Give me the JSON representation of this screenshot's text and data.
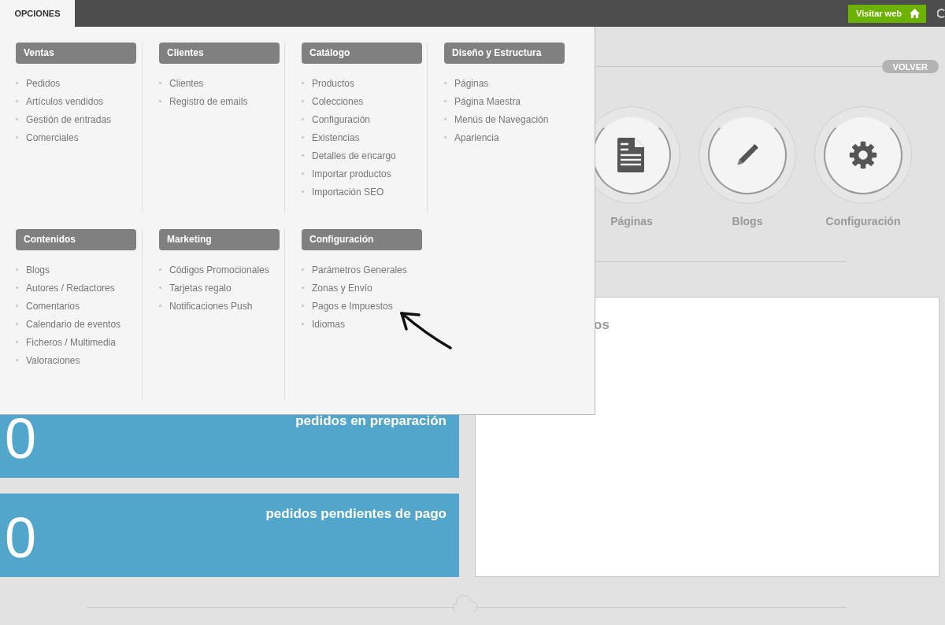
{
  "top_bar": {
    "tab": {
      "label": "OPCIONES",
      "selected": true
    },
    "visit_button": "Visitar web"
  },
  "menu": {
    "rows": [
      [
        {
          "title": "Ventas",
          "items": [
            "Pedidos",
            "Artículos vendidos",
            "Gestión de entradas",
            "Comerciales"
          ]
        },
        {
          "title": "Clientes",
          "items": [
            "Clientes",
            "Registro de emails"
          ]
        },
        {
          "title": "Catálogo",
          "items": [
            "Productos",
            "Colecciones",
            "Configuración",
            "Existencias",
            "Detalles de encargo",
            "Importar productos",
            "Importación SEO"
          ]
        },
        {
          "title": "Diseño y Estructura",
          "items": [
            "Páginas",
            "Página Maestra",
            "Menús de Navegación",
            "Apariencia"
          ]
        }
      ],
      [
        {
          "title": "Contenidos",
          "items": [
            "Blogs",
            "Autores / Redactores",
            "Comentarios",
            "Calendario de eventos",
            "Ficheros / Multimedia",
            "Valoraciones"
          ]
        },
        {
          "title": "Marketing",
          "items": [
            "Códigos Promocionales",
            "Tarjetas regalo",
            "Notificaciones Push"
          ]
        },
        {
          "title": "Configuración",
          "items": [
            "Parámetros Generales",
            "Zonas y Envío",
            "Pagos e Impuestos",
            "Idiomas"
          ]
        }
      ]
    ]
  },
  "volver_button": "VOLVER",
  "shortcuts": [
    {
      "label": "Páginas",
      "kind": "document"
    },
    {
      "label": "Blogs",
      "kind": "pencil"
    },
    {
      "label": "Configuración",
      "kind": "gear"
    }
  ],
  "stats": [
    {
      "value": "0",
      "label": "pedidos en preparación"
    },
    {
      "value": "0",
      "label": "pedidos pendientes de pago"
    }
  ],
  "panel": {
    "title": "os"
  }
}
